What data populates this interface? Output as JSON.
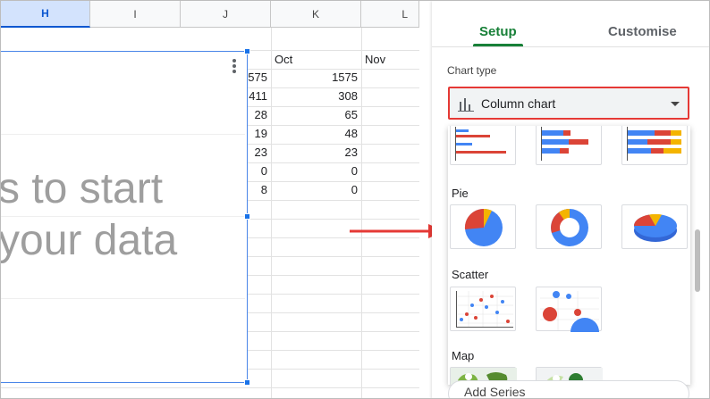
{
  "sheet": {
    "columns": [
      "H",
      "I",
      "J",
      "K",
      "L"
    ],
    "k_header": "Oct",
    "l_header": "Nov",
    "j_values": [
      "575",
      "411",
      "28",
      "19",
      "23",
      "0",
      "8"
    ],
    "k_values": [
      "1575",
      "308",
      "65",
      "48",
      "23",
      "0",
      "0"
    ]
  },
  "chart_placeholder": {
    "line1": "s to start",
    "line2": "your data"
  },
  "panel": {
    "tab_setup": "Setup",
    "tab_customise": "Customise",
    "chart_type_label": "Chart type",
    "chart_type_value": "Column chart",
    "sections": {
      "pie": "Pie",
      "scatter": "Scatter",
      "map": "Map"
    },
    "add_series": "Add Series"
  },
  "colors": {
    "blue": "#4285f4",
    "red": "#db4437",
    "yellow": "#f4b400",
    "green": "#188038",
    "highlight": "#e53935"
  }
}
